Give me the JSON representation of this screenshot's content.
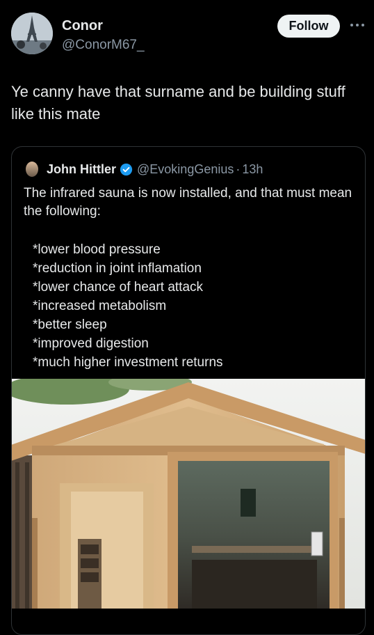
{
  "author": {
    "name": "Conor",
    "handle": "@ConorM67_",
    "follow_label": "Follow"
  },
  "post": {
    "text": "Ye canny have that surname and be building stuff like this mate"
  },
  "quoted": {
    "name": "John Hittler",
    "handle": "@EvokingGenius",
    "separator": "·",
    "time": "13h",
    "intro": "The infrared sauna is now installed, and that must mean the following:",
    "items": [
      "*lower blood pressure",
      "*reduction in joint inflamation",
      "*lower chance of heart attack",
      "*increased metabolism",
      "*better sleep",
      "*improved digestion",
      "*much higher investment returns"
    ],
    "image_subject": "wooden-sauna-cabin-photo"
  },
  "colors": {
    "background": "#000000",
    "text": "#e7e9ea",
    "secondary": "#8b98a5",
    "verified": "#1d9bf0",
    "border": "#2f3336"
  },
  "icons": [
    "more-options-icon",
    "verified-badge-icon"
  ]
}
